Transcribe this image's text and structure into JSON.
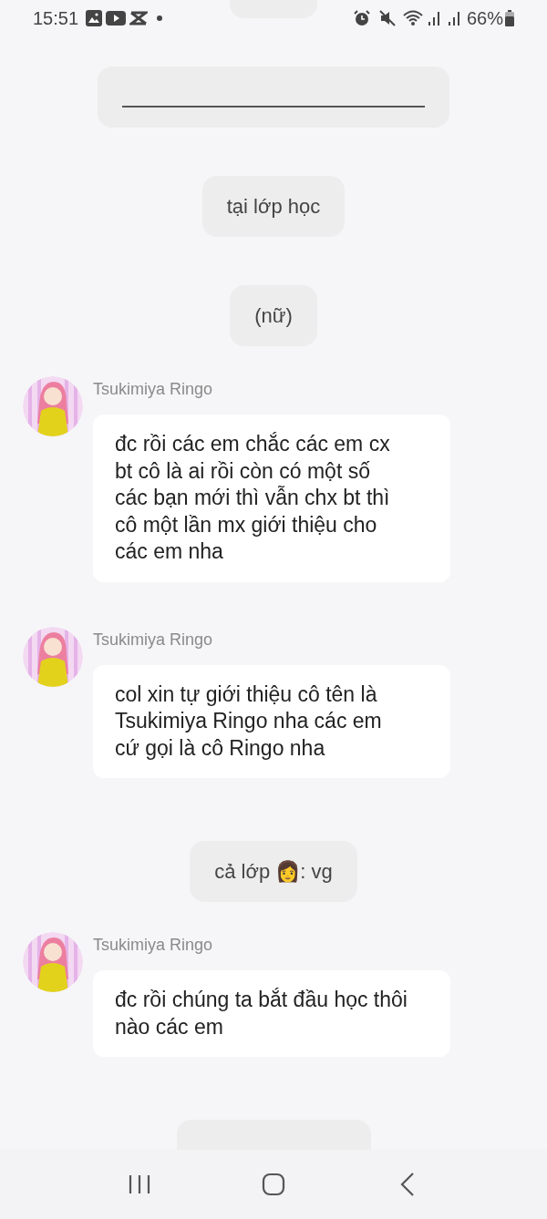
{
  "status_bar": {
    "time": "15:51",
    "battery": "66%"
  },
  "messages": [
    {
      "kind": "blank"
    },
    {
      "kind": "blank_line"
    },
    {
      "kind": "system",
      "text": "tại lớp học"
    },
    {
      "kind": "system",
      "text": "(nữ)"
    },
    {
      "kind": "chat",
      "sender": "Tsukimiya Ringo",
      "text": "đc rồi các em chắc các em cx bt cô là ai rồi còn có một số các bạn mới thì vẫn chx bt thì cô một lần mx giới thiệu cho các em nha"
    },
    {
      "kind": "chat",
      "sender": "Tsukimiya Ringo",
      "text": "col xin tự giới thiệu cô tên là Tsukimiya Ringo nha các em cứ gọi là cô Ringo nha"
    },
    {
      "kind": "system",
      "text": "cả lớp 👩: vg"
    },
    {
      "kind": "chat",
      "sender": "Tsukimiya Ringo",
      "text": "đc rồi chúng ta bắt đầu học thôi nào các em"
    },
    {
      "kind": "cut"
    }
  ]
}
